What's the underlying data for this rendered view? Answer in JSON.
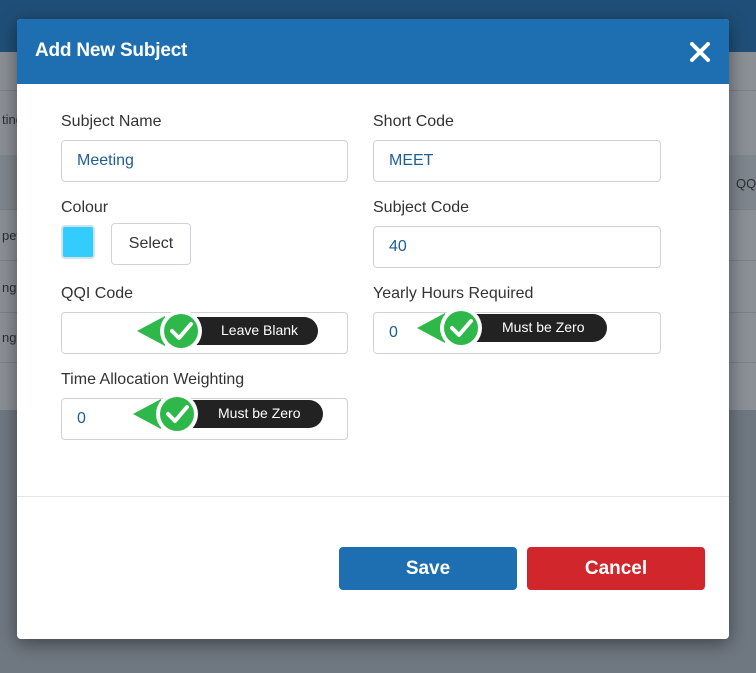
{
  "background": {
    "row_labels": [
      "ting",
      "pev",
      "ng",
      "ng"
    ],
    "header_fragment": "QQ"
  },
  "modal": {
    "title": "Add New Subject",
    "fields": {
      "subject_name": {
        "label": "Subject Name",
        "value": "Meeting"
      },
      "short_code": {
        "label": "Short Code",
        "value": "MEET"
      },
      "colour": {
        "label": "Colour",
        "swatch_color": "#33ccff",
        "select_label": "Select"
      },
      "subject_code": {
        "label": "Subject Code",
        "value": "40"
      },
      "qqi_code": {
        "label": "QQI Code",
        "value": ""
      },
      "yearly_hours": {
        "label": "Yearly Hours Required",
        "value": "0"
      },
      "time_allocation": {
        "label": "Time Allocation Weighting",
        "value": "0"
      }
    },
    "buttons": {
      "save": "Save",
      "cancel": "Cancel"
    }
  },
  "annotations": {
    "qqi_code": "Leave Blank",
    "yearly_hours": "Must be Zero",
    "time_allocation": "Must be Zero"
  },
  "colors": {
    "header_blue": "#1d6fb2",
    "cancel_red": "#d0262c",
    "check_green": "#2fb84a",
    "callout_dark": "#222222"
  }
}
